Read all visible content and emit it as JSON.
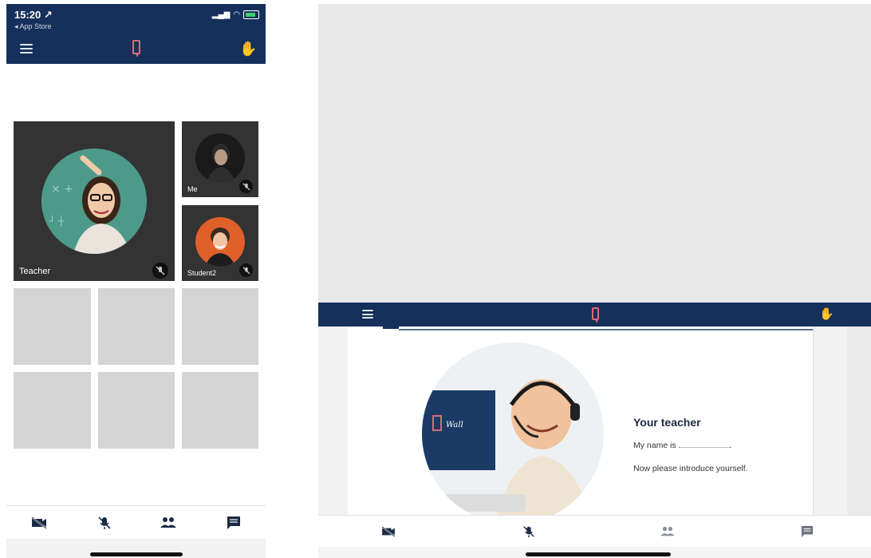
{
  "phone": {
    "status": {
      "time": "15:20 ↗",
      "back": "◂ App Store"
    },
    "participants": [
      {
        "label": "Teacher"
      },
      {
        "label": "Me"
      },
      {
        "label": "Student2"
      }
    ],
    "bottom_bar": [
      "camera-off-icon",
      "mic-off-icon",
      "participants-icon",
      "chat-icon"
    ]
  },
  "tablet": {
    "slide": {
      "title": "Your teacher",
      "line1": "My name is",
      "line1_end": ".",
      "line2": "Now please introduce yourself."
    },
    "bottom_bar": [
      "camera-off-icon",
      "mic-off-icon",
      "participants-icon",
      "chat-icon"
    ]
  },
  "colors": {
    "header": "#15305a",
    "tile": "#333333",
    "placeholder": "#d4d4d4",
    "logo_accent": "#e06878"
  }
}
